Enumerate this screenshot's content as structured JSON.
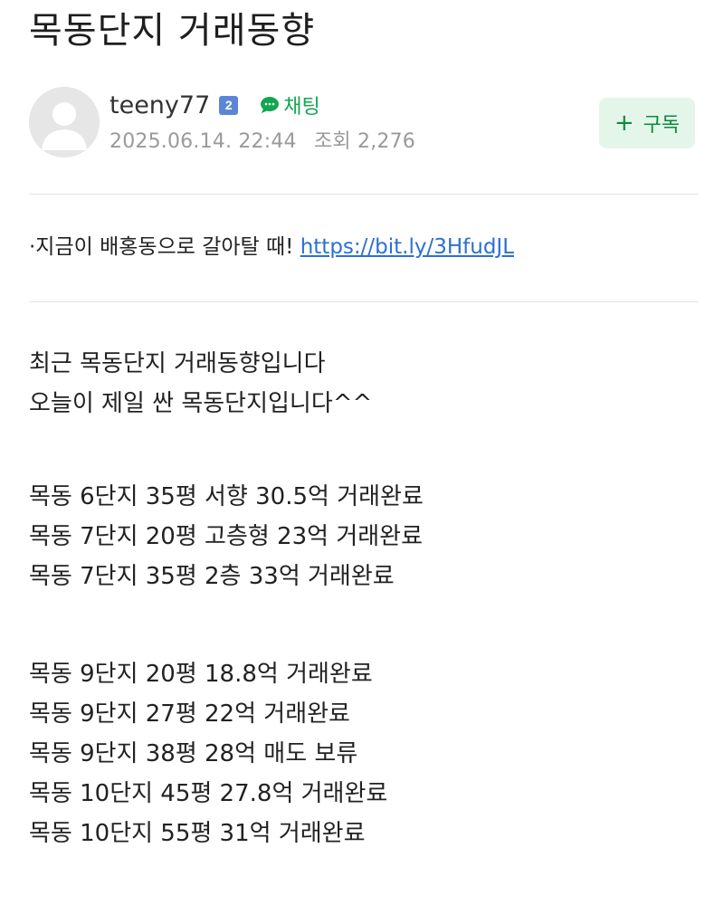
{
  "post": {
    "title": "목동단지 거래동향"
  },
  "author": {
    "nickname": "teeny77",
    "level": "2",
    "chat_label": "채팅",
    "date": "2025.06.14. 22:44",
    "views": "조회 2,276",
    "subscribe_label": "구독"
  },
  "promo": {
    "prefix": "·지금이 배홍동으로 갈아탈 때! ",
    "link": "https://bit.ly/3HfudJL"
  },
  "content": {
    "intro": [
      "최근 목동단지 거래동향입니다",
      "오늘이 제일 싼 목동단지입니다^^"
    ],
    "group1": [
      "목동 6단지 35평 서향 30.5억 거래완료",
      "목동 7단지 20평 고층형 23억 거래완료",
      "목동 7단지 35평 2층 33억 거래완료"
    ],
    "group2": [
      "목동 9단지 20평 18.8억 거래완료",
      "목동 9단지 27평 22억 거래완료",
      "목동 9단지 38평 28억 매도 보류",
      "목동 10단지 45평 27.8억 거래완료",
      "목동 10단지 55평 31억 거래완료"
    ]
  },
  "colors": {
    "accent_green": "#12a650",
    "link_blue": "#2b6fd6",
    "subscribe_bg": "#e4f6ea"
  }
}
